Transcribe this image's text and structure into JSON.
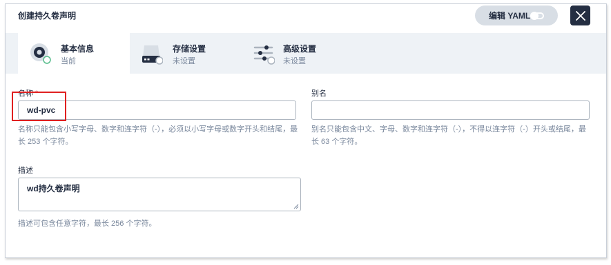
{
  "dialog": {
    "title": "创建持久卷声明",
    "yaml_toggle_label": "编辑 YAML"
  },
  "tabs": [
    {
      "title": "基本信息",
      "status": "当前",
      "icon": "disk-icon",
      "active": true
    },
    {
      "title": "存储设置",
      "status": "未设置",
      "icon": "storage-icon",
      "active": false
    },
    {
      "title": "高级设置",
      "status": "未设置",
      "icon": "sliders-icon",
      "active": false
    }
  ],
  "form": {
    "name": {
      "label": "名称",
      "required_mark": "*",
      "value": "wd-pvc",
      "hint_line1": "名称只能包含小写字母、数字和连字符（-），必须以小写字母或数字开头和结尾，最",
      "hint_line2": "长 253 个字符。"
    },
    "alias": {
      "label": "别名",
      "value": "",
      "hint_line1": "别名只能包含中文、字母、数字和连字符（-），不得以连字符（-）开头或结尾，最",
      "hint_line2": "长 63 个字符。"
    },
    "description": {
      "label": "描述",
      "value": "wd持久卷声明",
      "hint": "描述可包含任意字符，最长 256 个字符。"
    }
  },
  "colors": {
    "accent_dark": "#242e42",
    "success_green": "#55bc8a",
    "required_red": "#ca2621",
    "highlight_red": "#e02020"
  }
}
